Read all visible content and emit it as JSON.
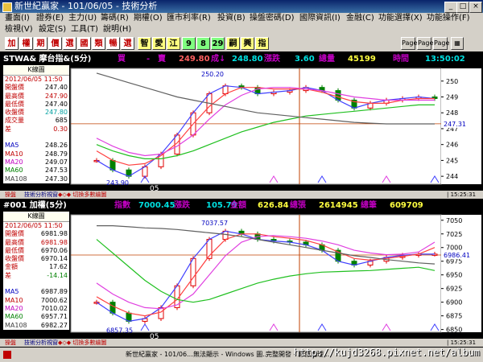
{
  "window": {
    "title": "新世紀贏家 - 101/06/05 - 技術分析",
    "min": "_",
    "max": "□",
    "close": "×"
  },
  "menu1": [
    "畫面(I)",
    "證券(E)",
    "主力(U)",
    "籌碼(R)",
    "期權(O)",
    "匯市利率(R)",
    "投資(B)",
    "操盤密碼(D)",
    "國際資訊(I)",
    "金融(C)",
    "功能選擇(X)",
    "功能操作(F)"
  ],
  "menu2": [
    "檢視(V)",
    "設定(S)",
    "工具(T)",
    "說明(H)"
  ],
  "toolbar": {
    "buttons": [
      {
        "label": "加",
        "bg": "#ffffff",
        "fg": "#c00000"
      },
      {
        "label": "權",
        "bg": "#ffffff",
        "fg": "#c00000"
      },
      {
        "label": "期",
        "bg": "#ffffff",
        "fg": "#c00000"
      },
      {
        "label": "價",
        "bg": "#ffffff",
        "fg": "#c00000"
      },
      {
        "label": "選",
        "bg": "#ffffff",
        "fg": "#c00000"
      },
      {
        "label": "國",
        "bg": "#ffffff",
        "fg": "#c00000"
      },
      {
        "label": "類",
        "bg": "#ffffff",
        "fg": "#c00000"
      },
      {
        "label": "暢",
        "bg": "#ffffff",
        "fg": "#c00000"
      },
      {
        "label": "選",
        "bg": "#ffffff",
        "fg": "#c00000"
      },
      {
        "label": "智",
        "bg": "#ffff80",
        "fg": "#000000"
      },
      {
        "label": "愛",
        "bg": "#ffff80",
        "fg": "#000000"
      },
      {
        "label": "江",
        "bg": "#ffff80",
        "fg": "#000000"
      },
      {
        "label": "9",
        "bg": "#80ff80",
        "fg": "#000000"
      },
      {
        "label": "8",
        "bg": "#80ff80",
        "fg": "#000000"
      },
      {
        "label": "29",
        "bg": "#80ff80",
        "fg": "#000000"
      },
      {
        "label": "嗣",
        "bg": "#ffff80",
        "fg": "#000000"
      },
      {
        "label": "興",
        "bg": "#ffff80",
        "fg": "#000000"
      },
      {
        "label": "指",
        "bg": "#ffff80",
        "fg": "#000000"
      }
    ],
    "text_buttons": [
      "Page",
      "Page",
      "Page"
    ]
  },
  "top": {
    "header": {
      "symbol": "STWA& 摩台指&(5分)",
      "buy_label": "買",
      "buy_value": "-",
      "sell_label": "賣",
      "sell_value": "249.80",
      "deal_label": "成↓",
      "deal_value": "248.80",
      "change_label": "漲跌",
      "change_value": "3.60",
      "volume_label": "總量",
      "volume_value": "45199",
      "time_label": "時間",
      "time_value": "13:50:02"
    },
    "info": {
      "title": "K線圖",
      "date": "2012/06/05 11:50",
      "rows": [
        {
          "k": "開盤價",
          "v": "247.40",
          "kc": "#c00000",
          "vc": "#000000"
        },
        {
          "k": "最高價",
          "v": "247.90",
          "kc": "#c00000",
          "vc": "#c00000"
        },
        {
          "k": "最低價",
          "v": "247.40",
          "kc": "#c00000",
          "vc": "#000000"
        },
        {
          "k": "收盤價",
          "v": "247.80",
          "kc": "#c00000",
          "vc": "#00a0a0"
        },
        {
          "k": "成交量",
          "v": "685",
          "kc": "#c00000",
          "vc": "#000000"
        },
        {
          "k": "差",
          "v": "0.30",
          "kc": "#c00000",
          "vc": "#c00000"
        },
        {
          "k": "",
          "v": "",
          "kc": "#000000",
          "vc": "#000000"
        },
        {
          "k": "MA5",
          "v": "248.26",
          "kc": "#0000c0",
          "vc": "#000000"
        },
        {
          "k": "MA10",
          "v": "248.79",
          "kc": "#c00000",
          "vc": "#000000"
        },
        {
          "k": "MA20",
          "v": "249.07",
          "kc": "#c000c0",
          "vc": "#000000"
        },
        {
          "k": "MA60",
          "v": "247.53",
          "kc": "#008000",
          "vc": "#000000"
        },
        {
          "k": "MA108",
          "v": "247.30",
          "kc": "#404040",
          "vc": "#000000"
        }
      ]
    },
    "axis": [
      "250",
      "249",
      "248",
      "247",
      "246",
      "245",
      "244"
    ],
    "price_marker": "247.31",
    "high_label": "250.20",
    "low_label": "243.90",
    "date_label": "05",
    "footer": [
      "操盤",
      "技術分析視窗",
      "◆◇◆ 切換多數繪圖"
    ],
    "footer_right": "| 15:25:31"
  },
  "bottom": {
    "header": {
      "symbol": "#001 加權(5分)",
      "index_label": "指數",
      "index_value": "7000.45",
      "change_label": "漲跌",
      "change_value": "105.79",
      "amount_label": "金額",
      "amount_value": "626.84",
      "volume_label": "總張",
      "volume_value": "2614945",
      "trades_label": "總筆",
      "trades_value": "609709"
    },
    "info": {
      "title": "K線圖",
      "date": "2012/06/05 11:50",
      "rows": [
        {
          "k": "開盤價",
          "v": "6981.98",
          "kc": "#c00000",
          "vc": "#000000"
        },
        {
          "k": "最高價",
          "v": "6981.98",
          "kc": "#c00000",
          "vc": "#c00000"
        },
        {
          "k": "最低價",
          "v": "6970.06",
          "kc": "#c00000",
          "vc": "#000000"
        },
        {
          "k": "收盤價",
          "v": "6970.14",
          "kc": "#c00000",
          "vc": "#000000"
        },
        {
          "k": "金額",
          "v": "17.62",
          "kc": "#c00000",
          "vc": "#000000"
        },
        {
          "k": "差",
          "v": "-14.14",
          "kc": "#c00000",
          "vc": "#008000"
        },
        {
          "k": "",
          "v": "",
          "kc": "#000000",
          "vc": "#000000"
        },
        {
          "k": "MA5",
          "v": "6987.89",
          "kc": "#0000c0",
          "vc": "#000000"
        },
        {
          "k": "MA10",
          "v": "7000.62",
          "kc": "#c00000",
          "vc": "#000000"
        },
        {
          "k": "MA20",
          "v": "7010.02",
          "kc": "#c000c0",
          "vc": "#000000"
        },
        {
          "k": "MA60",
          "v": "6957.71",
          "kc": "#008000",
          "vc": "#000000"
        },
        {
          "k": "MA108",
          "v": "6982.27",
          "kc": "#404040",
          "vc": "#000000"
        }
      ]
    },
    "axis": [
      "7050",
      "7025",
      "7000",
      "6975",
      "6950",
      "6925",
      "6900",
      "6875",
      "6850"
    ],
    "price_marker": "6986.41",
    "high_label": "7037.57",
    "low_label": "6857.35",
    "date_label": "05",
    "footer": [
      "操盤",
      "技術分析視窗",
      "◆◇◆ 切換多數繪圖"
    ],
    "footer_right": "| 15:25:31"
  },
  "status": [
    "新世紀贏家 - 101/06...",
    "無法顯示 - Windows 圖...",
    "完整開發 - 影像處理..."
  ],
  "watermark": "http://kujd3268.pixnet.net/album",
  "chart_data": [
    {
      "type": "candlestick",
      "series": [
        {
          "name": "MA5",
          "values": [
            245.0,
            244.4,
            244.0,
            244.6,
            245.4,
            246.6,
            248.0,
            249.2,
            249.7,
            249.6,
            249.2,
            249.3,
            249.4,
            249.6,
            249.4,
            248.8,
            248.3,
            248.6,
            248.8,
            248.9,
            249.0,
            248.9
          ]
        },
        {
          "name": "MA10",
          "values": [
            245.6,
            245.0,
            244.7,
            244.8,
            245.3,
            246.1,
            247.3,
            248.4,
            249.2,
            249.6,
            249.6,
            249.5,
            249.5,
            249.5,
            249.3,
            249.0,
            248.7,
            248.6,
            248.6,
            248.8,
            248.9,
            248.9
          ]
        },
        {
          "name": "MA20",
          "values": [
            246.4,
            245.9,
            245.5,
            245.3,
            245.4,
            245.9,
            246.6,
            247.6,
            248.5,
            249.1,
            249.5,
            249.6,
            249.6,
            249.5,
            249.4,
            249.2,
            249.0,
            248.9,
            248.8,
            248.8,
            248.8,
            248.8
          ]
        },
        {
          "name": "MA60",
          "values": [
            246.0,
            245.6,
            245.3,
            245.1,
            245.1,
            245.3,
            245.6,
            246.0,
            246.4,
            246.8,
            247.1,
            247.4,
            247.6,
            247.8,
            247.9,
            248.0,
            248.1,
            248.2,
            248.3,
            248.4,
            248.5,
            248.5
          ]
        },
        {
          "name": "MA108",
          "values": [
            250.5,
            250.2,
            249.9,
            249.6,
            249.3,
            249.0,
            248.8,
            248.6,
            248.4,
            248.2,
            248.0,
            247.9,
            247.8,
            247.7,
            247.6,
            247.5,
            247.4,
            247.35,
            247.3,
            247.3,
            247.3,
            247.3
          ]
        }
      ],
      "ylim": [
        243.5,
        250.8
      ],
      "high": 250.2,
      "low": 243.9,
      "current": 247.31,
      "x_label": "05"
    },
    {
      "type": "candlestick",
      "series": [
        {
          "name": "MA5",
          "values": [
            6900,
            6880,
            6865,
            6870,
            6890,
            6930,
            6980,
            7015,
            7030,
            7025,
            7015,
            7012,
            7010,
            7005,
            6995,
            6975,
            6968,
            6975,
            6982,
            6986,
            6988,
            6988
          ]
        },
        {
          "name": "MA10",
          "values": [
            6910,
            6893,
            6880,
            6875,
            6882,
            6905,
            6945,
            6985,
            7015,
            7025,
            7025,
            7020,
            7017,
            7013,
            7005,
            6992,
            6980,
            6977,
            6980,
            6984,
            6988,
            7000
          ]
        },
        {
          "name": "MA20",
          "values": [
            6935,
            6915,
            6900,
            6890,
            6888,
            6895,
            6915,
            6950,
            6985,
            7010,
            7020,
            7022,
            7020,
            7017,
            7012,
            7005,
            6995,
            6990,
            6987,
            6988,
            6992,
            7010
          ]
        },
        {
          "name": "MA60",
          "values": [
            7015,
            6990,
            6965,
            6940,
            6920,
            6905,
            6900,
            6905,
            6915,
            6925,
            6935,
            6942,
            6948,
            6952,
            6955,
            6956,
            6957,
            6958,
            6960,
            6962,
            6964,
            6958
          ]
        },
        {
          "name": "MA108",
          "values": [
            7040,
            7040,
            7038,
            7036,
            7035,
            7033,
            7030,
            7027,
            7024,
            7020,
            7015,
            7010,
            7005,
            7000,
            6995,
            6990,
            6985,
            6982,
            6978,
            6975,
            6972,
            6970
          ]
        }
      ],
      "ylim": [
        6845,
        7060
      ],
      "high": 7037.57,
      "low": 6857.35,
      "current": 6986.41,
      "x_label": "05"
    }
  ]
}
